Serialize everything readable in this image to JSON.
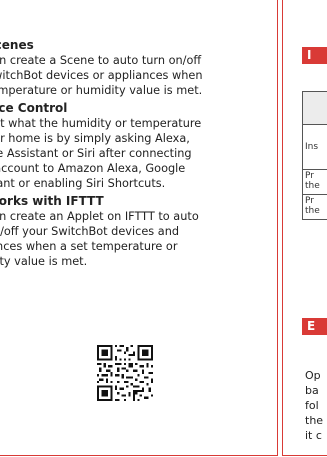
{
  "left": {
    "sections": [
      {
        "title": "Scenes",
        "lines": [
          "can create a Scene to auto turn on/off",
          "SwitchBot devices or appliances when",
          "temperature or humidity value is met."
        ]
      },
      {
        "title": "oice Control",
        "lines": [
          "out what the humidity or temperature",
          "our home is by simply asking Alexa,",
          "gle Assistant or Siri after connecting",
          "r account to Amazon Alexa, Google",
          "stant or enabling Siri Shortcuts."
        ]
      },
      {
        "title": "Works with IFTTT",
        "lines": [
          "can create an Applet on IFTTT to auto",
          "on/off your SwitchBot devices and",
          "iances when a set temperature or",
          "idity value is met."
        ]
      }
    ]
  },
  "right": {
    "header_1": "I",
    "table_rows": [
      "Ins",
      "Pr\nthe",
      "Pr\nthe"
    ],
    "header_2": "E",
    "text_lines": [
      "Op",
      "ba",
      "fol",
      "the",
      "it c"
    ]
  },
  "colors": {
    "accent": "#d93a36"
  }
}
